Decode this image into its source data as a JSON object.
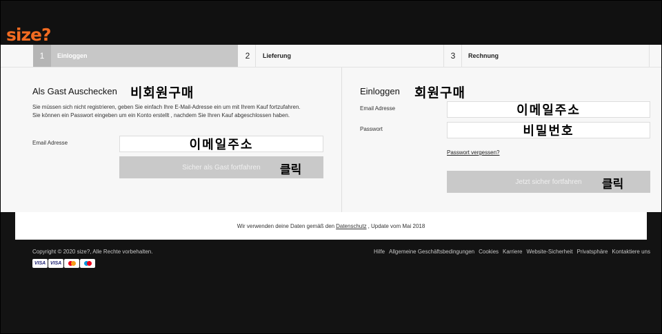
{
  "brand": {
    "logo_text": "size",
    "logo_mark": "?"
  },
  "steps": [
    {
      "num": "1",
      "label": "Einloggen",
      "active": true
    },
    {
      "num": "2",
      "label": "Lieferung",
      "active": false
    },
    {
      "num": "3",
      "label": "Rechnung",
      "active": false
    }
  ],
  "guest": {
    "title": "Als Gast Auschecken",
    "overlay_title": "비회원구매",
    "description": "Sie müssen sich nicht registrieren, geben Sie einfach Ihre E-Mail-Adresse ein um mit Ihrem Kauf fortzufahren. Sie können ein Passwort eingeben um ein Konto erstellt , nachdem Sie Ihren Kauf abgeschlossen haben.",
    "email_label": "Email Adresse",
    "email_overlay": "이메일주소",
    "button_label": "Sicher als Gast fortfahren",
    "button_overlay": "클릭"
  },
  "login": {
    "title": "Einloggen",
    "overlay_title": "회원구매",
    "email_label": "Email Adresse",
    "email_overlay": "이메일주소",
    "password_label": "Passwort",
    "password_overlay": "비밀번호",
    "forgot_link": "Passwort vergessen?",
    "button_label": "Jetzt sicher fortfahren",
    "button_overlay": "클릭"
  },
  "notice": {
    "before": "Wir verwenden deine Daten gemäß den",
    "link": "Datenschutz",
    "after": ", Update vom Mai 2018"
  },
  "footer": {
    "copyright": "Copyright © 2020 size?, Alle Rechte vorbehalten.",
    "cards": [
      "VISA",
      "VISA"
    ],
    "links": [
      "Hilfe",
      "Allgemeine Geschäftsbedingungen",
      "Cookies",
      "Karriere",
      "Website-Sicherheit",
      "Privatsphäre",
      "Kontaktiere uns"
    ]
  },
  "colors": {
    "brand_orange": "#f26b21",
    "button_gray": "#c9c9c9",
    "footer_bg": "#131313"
  }
}
